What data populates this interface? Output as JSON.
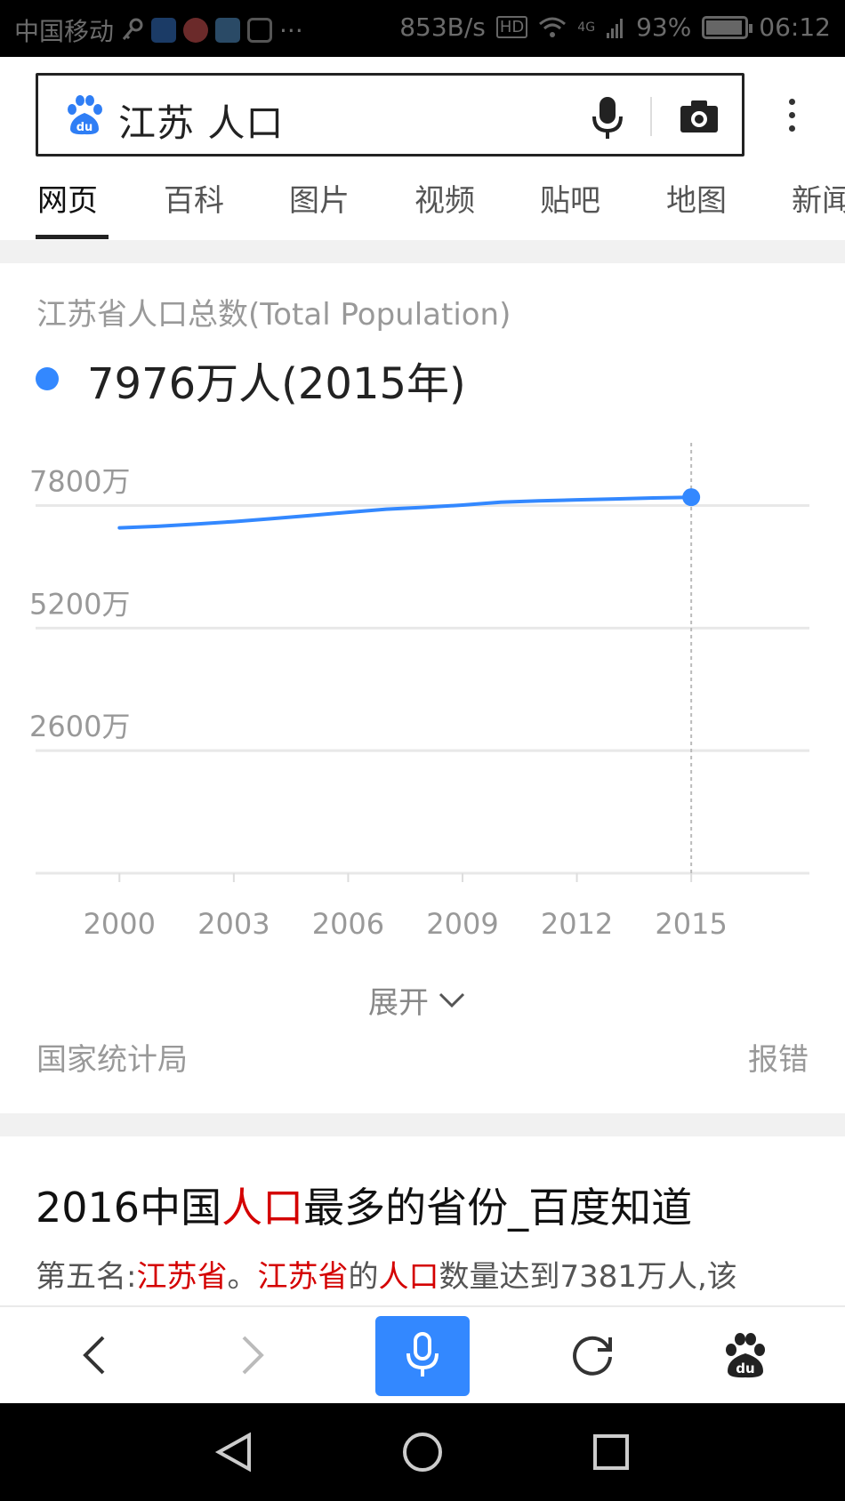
{
  "status_bar": {
    "carrier": "中国移动",
    "speed": "853B/s",
    "hd": "HD",
    "network": "4G",
    "battery": "93%",
    "time": "06:12"
  },
  "search": {
    "query": "江苏 人口"
  },
  "tabs": [
    {
      "label": "网页"
    },
    {
      "label": "百科"
    },
    {
      "label": "图片"
    },
    {
      "label": "视频"
    },
    {
      "label": "贴吧"
    },
    {
      "label": "地图"
    },
    {
      "label": "新闻"
    }
  ],
  "card": {
    "title": "江苏省人口总数(Total Population)",
    "value": "7976万人(2015年)",
    "expand_label": "展开",
    "source": "国家统计局",
    "report": "报错"
  },
  "chart_data": {
    "type": "line",
    "x": [
      2000,
      2001,
      2002,
      2003,
      2004,
      2005,
      2006,
      2007,
      2008,
      2009,
      2010,
      2011,
      2012,
      2013,
      2014,
      2015
    ],
    "y_wan": [
      7327,
      7359,
      7406,
      7458,
      7523,
      7588,
      7656,
      7723,
      7762,
      7810,
      7869,
      7899,
      7920,
      7939,
      7960,
      7976
    ],
    "x_tick_labels": [
      "2000",
      "2003",
      "2006",
      "2009",
      "2012",
      "2015"
    ],
    "y_tick_labels": [
      "7800万",
      "5200万",
      "2600万"
    ],
    "y_ticks": [
      7800,
      5200,
      2600
    ],
    "ylim": [
      0,
      8300
    ],
    "xlim": [
      1997.8,
      2018.1
    ],
    "highlight": {
      "x": 2015,
      "y": 7976
    },
    "grid": true,
    "colors": {
      "line": "#3388ff",
      "grid": "#e8e8e8",
      "axis_text": "#999999"
    }
  },
  "result": {
    "title_parts": [
      {
        "text": "2016中国",
        "hl": false
      },
      {
        "text": "人口",
        "hl": true
      },
      {
        "text": "最多的省份_百度知道",
        "hl": false
      }
    ],
    "snippet_parts": [
      {
        "text": "第五名:",
        "hl": false
      },
      {
        "text": "江苏省",
        "hl": true
      },
      {
        "text": "。",
        "hl": false
      },
      {
        "text": "江苏省",
        "hl": true
      },
      {
        "text": "的",
        "hl": false
      },
      {
        "text": "人口",
        "hl": true
      },
      {
        "text": "数量达到7381万人,该",
        "hl": false
      }
    ]
  },
  "colors": {
    "accent": "#3388ff",
    "highlight": "#d40000"
  }
}
